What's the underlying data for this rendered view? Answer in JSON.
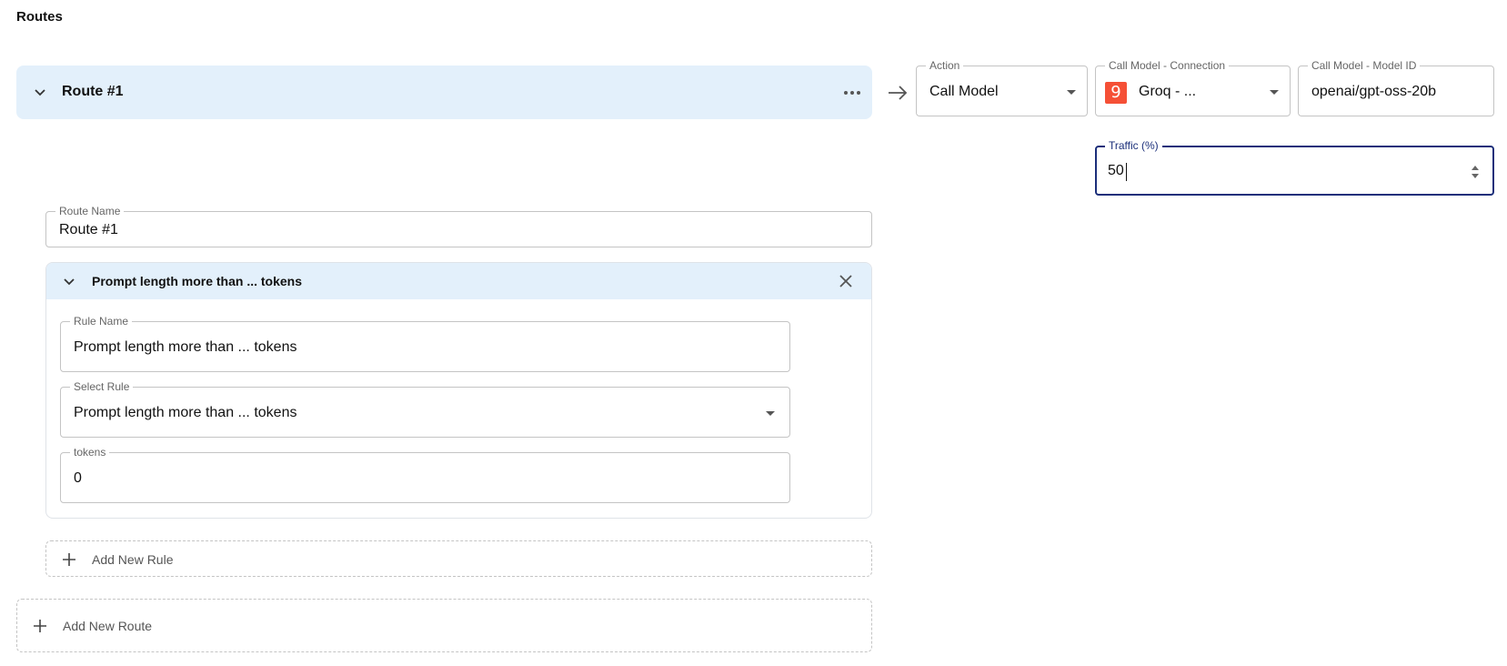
{
  "page": {
    "title": "Routes"
  },
  "route": {
    "header_title": "Route #1",
    "action": {
      "label": "Action",
      "value": "Call Model"
    },
    "connection": {
      "label": "Call Model - Connection",
      "value": "Groq - ...",
      "logo_glyph": "9",
      "logo_color": "#f55036"
    },
    "model_id": {
      "label": "Call Model - Model ID",
      "value": "openai/gpt-oss-20b"
    },
    "traffic": {
      "label": "Traffic (%)",
      "value": "50"
    },
    "route_name": {
      "label": "Route Name",
      "value": "Route #1"
    }
  },
  "rule": {
    "header_title": "Prompt length more than ... tokens",
    "rule_name": {
      "label": "Rule Name",
      "value": "Prompt length more than ... tokens"
    },
    "select_rule": {
      "label": "Select Rule",
      "value": "Prompt length more than ... tokens"
    },
    "tokens": {
      "label": "tokens",
      "value": "0"
    }
  },
  "buttons": {
    "add_rule": "Add New Rule",
    "add_route": "Add New Route"
  },
  "colors": {
    "accent": "#1b2f7a",
    "header_bg": "#e3f0fb"
  },
  "icons": [
    "chevron-down-icon",
    "more-horizontal-icon",
    "arrow-right-icon",
    "close-icon",
    "plus-icon",
    "spinner-arrows-icon"
  ]
}
